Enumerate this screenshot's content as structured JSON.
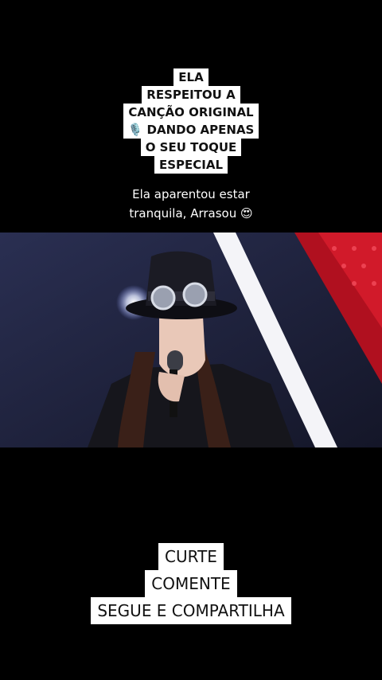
{
  "top_caption": {
    "lines": [
      "ELA",
      "RESPEITOU A",
      "CANÇÃO ORIGINAL",
      "🎙️ DANDO APENAS",
      "O SEU TOQUE",
      "ESPECIAL"
    ]
  },
  "subtitle": {
    "line1": "Ela aparentou estar",
    "line2": "tranquila, Arrasou 😍"
  },
  "bottom_caption": {
    "lines": [
      "CURTE",
      "COMENTE",
      "SEGUE E COMPARTILHA"
    ]
  },
  "colors": {
    "background": "#000000",
    "caption_bg": "#ffffff",
    "stage_red": "#c8102e"
  }
}
